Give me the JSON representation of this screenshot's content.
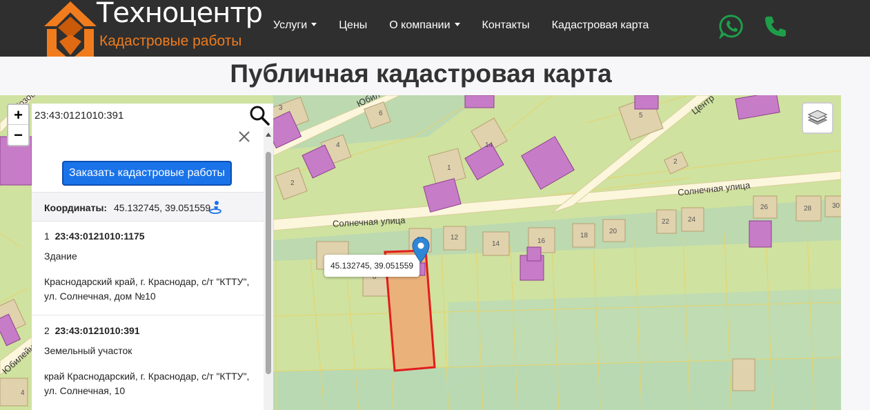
{
  "header": {
    "logo_title": "Техноцентр",
    "logo_subtitle": "Кадастровые работы",
    "nav": [
      {
        "label": "Услуги",
        "dropdown": true
      },
      {
        "label": "Цены",
        "dropdown": false
      },
      {
        "label": "О компании",
        "dropdown": true
      },
      {
        "label": "Контакты",
        "dropdown": false
      },
      {
        "label": "Кадастровая карта",
        "dropdown": false
      }
    ],
    "whatsapp_icon": "whatsapp-icon",
    "phone_icon": "phone-icon",
    "accent_color": "#f07c1e",
    "social_color": "#1e9e4a"
  },
  "page_title": "Публичная кадастровая карта",
  "map": {
    "zoom_in": "+",
    "zoom_out": "−",
    "search_value": "23:43:0121010:391",
    "marker_label": "45.132745, 39.051559",
    "streets": {
      "solnechnaya_1": "Солнечная улица",
      "solnechnaya_2": "Солнечная улица",
      "yubileynaya_top": "Юбил",
      "yubileynaya_left": "Юбилейная",
      "centralnaya": "Центр",
      "rozovaya": "Розов"
    },
    "lot_numbers": [
      "6",
      "3",
      "4",
      "2",
      "1",
      "14",
      "5",
      "2",
      "10",
      "12",
      "14",
      "16",
      "18",
      "20",
      "22",
      "24",
      "26",
      "28",
      "30",
      "8",
      "4"
    ]
  },
  "panel": {
    "order_button": "Заказать кадастровые работы",
    "coords_label": "Координаты:",
    "coords_value": "45.132745, 39.051559",
    "results": [
      {
        "index": "1",
        "number": "23:43:0121010:1175",
        "type": "Здание",
        "address_line1": "Краснодарский край, г. Краснодар, с/т \"КТТУ\",",
        "address_line2": "ул. Солнечная, дом №10"
      },
      {
        "index": "2",
        "number": "23:43:0121010:391",
        "type": "Земельный участок",
        "address_line1": "край Краснодарский, г. Краснодар, с/т \"КТТУ\",",
        "address_line2": "ул. Солнечная, 10"
      }
    ]
  }
}
